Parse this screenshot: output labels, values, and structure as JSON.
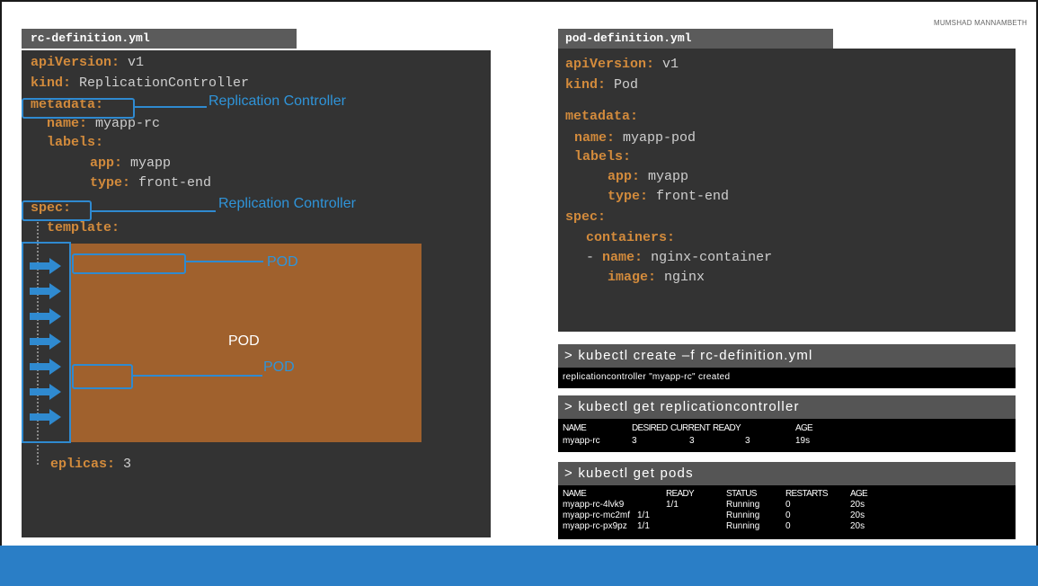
{
  "author": "MUMSHAD MANNAMBETH",
  "rc_file": {
    "filename": "rc-definition.yml",
    "lines": {
      "api_key": "apiVersion:",
      "api_val": "v1",
      "kind_key": "kind:",
      "kind_val": "ReplicationController",
      "metadata_key": "metadata:",
      "name_key": "name:",
      "name_val": "myapp-rc",
      "labels_key": "labels:",
      "app_key": "app:",
      "app_val": "myapp",
      "type_key": "type:",
      "type_val": "front-end",
      "spec_key": "spec:",
      "template_key": "template:",
      "replicas_key": "eplicas:",
      "replicas_val": "3"
    },
    "callouts": [
      "Replication Controller",
      "Replication Controller"
    ],
    "pod_center": "POD",
    "pod_labels": [
      "POD",
      "POD"
    ]
  },
  "pod_file": {
    "filename": "pod-definition.yml",
    "lines": {
      "api_key": "apiVersion:",
      "api_val": "v1",
      "kind_key": "kind:",
      "kind_val": "Pod",
      "metadata_key": "metadata:",
      "name_key": "name:",
      "name_val": "myapp-pod",
      "labels_key": "labels:",
      "app_key": "app:",
      "app_val": "myapp",
      "type_key": "type:",
      "type_val": "front-end",
      "spec_key": "spec:",
      "containers_key": "containers:",
      "dash": "-",
      "cname_key": "name:",
      "cname_val": "nginx-container",
      "image_key": "image:",
      "image_val": "nginx"
    }
  },
  "terminal1": {
    "command": "> kubectl create –f rc-definition.yml",
    "output": "replicationcontroller \"myapp-rc\" created"
  },
  "terminal2": {
    "command": "> kubectl get replicationcontroller",
    "headers": [
      "NAME",
      "DESIRED",
      "CURRENT",
      "READY",
      "AGE"
    ],
    "row": [
      "myapp-rc",
      "3",
      "3",
      "3",
      "19s"
    ]
  },
  "terminal3": {
    "command": "> kubectl get pods",
    "headers": [
      "NAME",
      "READY",
      "STATUS",
      "RESTARTS",
      "AGE"
    ],
    "rows": [
      [
        "myapp-rc-4lvk9",
        "1/1",
        "Running",
        "0",
        "20s"
      ],
      [
        "myapp-rc-mc2mf",
        "1/1",
        "Running",
        "0",
        "20s"
      ],
      [
        "myapp-rc-px9pz",
        "1/1",
        "Running",
        "0",
        "20s"
      ]
    ]
  },
  "colors": {
    "accent": "#2f8ad0",
    "pod_block": "#a0612d",
    "yaml_key": "#d38b3c",
    "panel_bg": "#333333",
    "band": "#2a7ec6"
  }
}
